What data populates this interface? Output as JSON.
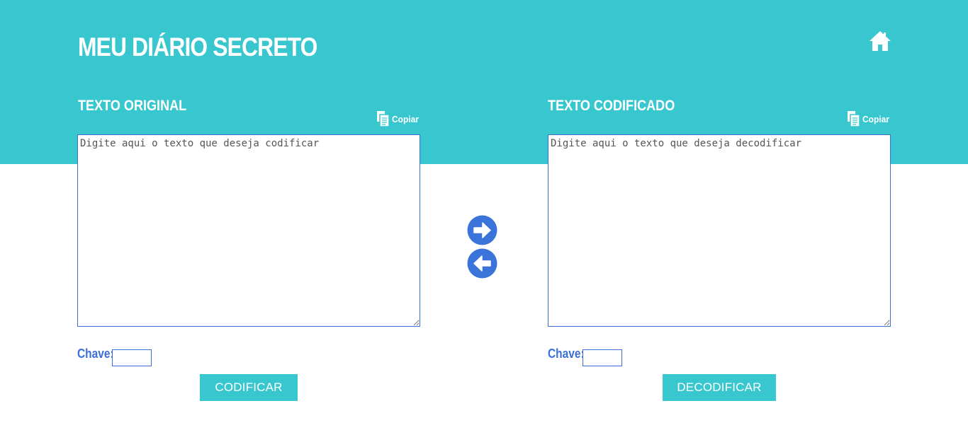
{
  "header": {
    "title": "MEU DIÁRIO SECRETO",
    "home_icon": "home-icon",
    "background_color": "#38c7cf"
  },
  "left": {
    "heading": "TEXTO ORIGINAL",
    "copy_label": "Copiar",
    "copy_icon": "copy-icon",
    "textarea": {
      "value": "",
      "placeholder": "Digite aqui o texto que deseja codificar"
    },
    "key_label": "Chave:",
    "key_value": "",
    "button_label": "CODIFICAR"
  },
  "right": {
    "heading": "TEXTO CODIFICADO",
    "copy_label": "Copiar",
    "copy_icon": "copy-icon",
    "textarea": {
      "value": "",
      "placeholder": "Digite aqui o texto que deseja decodificar"
    },
    "key_label": "Chave:",
    "key_value": "",
    "button_label": "DECODIFICAR"
  },
  "arrows": {
    "forward_icon": "arrow-right-circle-icon",
    "backward_icon": "arrow-left-circle-icon",
    "color": "#3a73d9"
  },
  "colors": {
    "accent": "#38c7cf",
    "blue": "#3a6fd8",
    "text_light": "#ffffff"
  }
}
